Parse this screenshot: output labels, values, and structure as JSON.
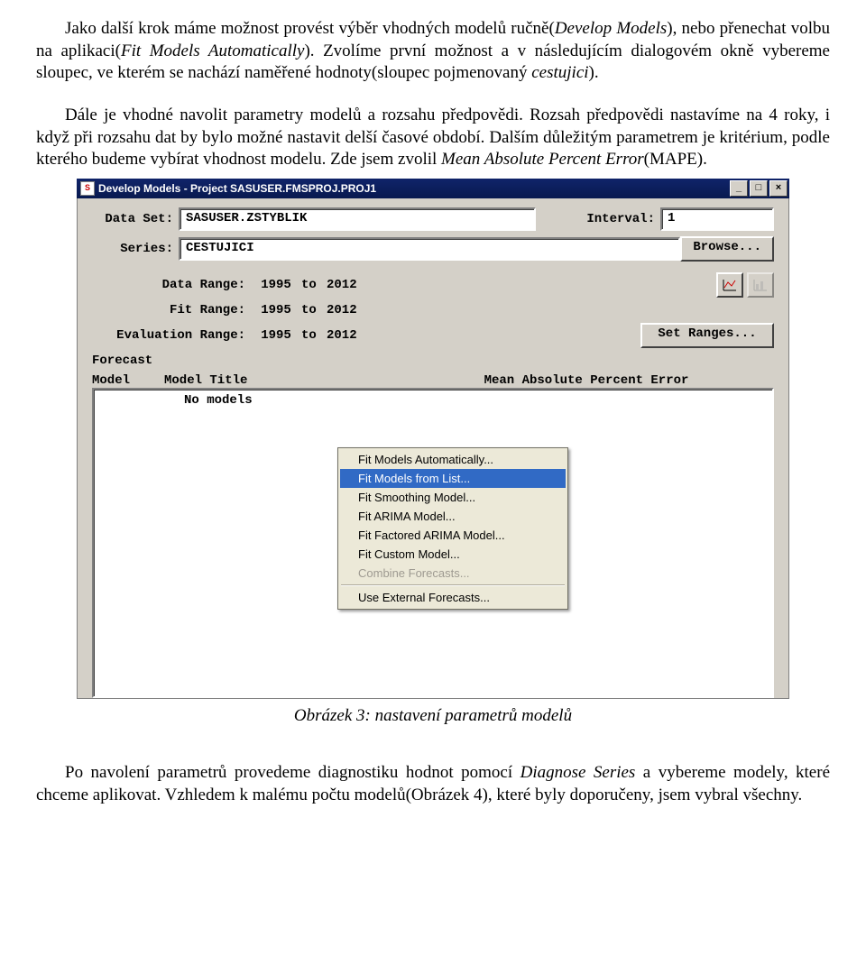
{
  "para1": "Jako další krok máme možnost provést výběr vhodných modelů ručně(",
  "para1a": "Develop Models",
  "para1b": "), nebo přenechat volbu na aplikaci(",
  "para1c": "Fit Models Automatically",
  "para1d": "). Zvolíme první možnost a v následujícím dialogovém okně vybereme sloupec, ve kterém se nachází naměřené hodnoty(sloupec pojmenovaný ",
  "para1e": "cestujici",
  "para1f": ").",
  "para2a": "Dále je vhodné navolit parametry modelů a rozsahu předpovědi. Rozsah předpovědi nastavíme na 4 roky, i když při rozsahu dat by bylo možné nastavit delší časové období. Dalším důležitým parametrem je kritérium, podle kterého budeme vybírat vhodnost modelu. Zde jsem zvolil ",
  "para2b": "Mean Absolute Percent Error",
  "para2c": "(MAPE).",
  "dialog": {
    "title": "Develop Models - Project SASUSER.FMSPROJ.PROJ1",
    "labels": {
      "dataSet": "Data Set:",
      "series": "Series:",
      "interval": "Interval:",
      "dataRange": "Data Range:",
      "fitRange": "Fit Range:",
      "evalRange": "Evaluation Range:",
      "to": "to",
      "forecast": "Forecast",
      "model": "Model",
      "modelTitle": "Model Title",
      "metric": "Mean Absolute Percent Error",
      "noModels": "No models"
    },
    "values": {
      "dataSet": "SASUSER.ZSTYBLIK",
      "series": "CESTUJICI",
      "interval": "1",
      "y1": "1995",
      "y2": "2012"
    },
    "buttons": {
      "browse": "Browse...",
      "setRanges": "Set Ranges..."
    },
    "menu": {
      "m1": "Fit Models Automatically...",
      "m2": "Fit Models from List...",
      "m3": "Fit Smoothing Model...",
      "m4": "Fit ARIMA Model...",
      "m5": "Fit Factored ARIMA Model...",
      "m6": "Fit Custom Model...",
      "m7": "Combine Forecasts...",
      "m8": "Use External Forecasts..."
    }
  },
  "caption": "Obrázek 3: nastavení parametrů modelů",
  "para3a": "Po navolení parametrů provedeme diagnostiku hodnot pomocí ",
  "para3b": "Diagnose Series",
  "para3c": " a vybereme modely, které chceme aplikovat. Vzhledem k malému počtu modelů(Obrázek 4), které byly doporučeny, jsem vybral všechny."
}
